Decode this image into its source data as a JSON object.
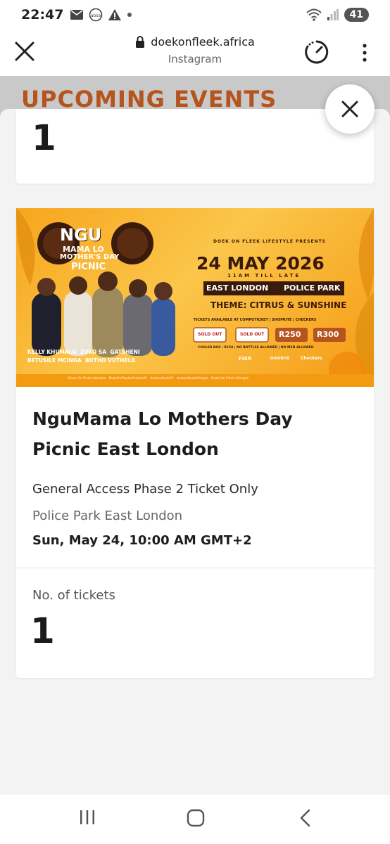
{
  "status_bar": {
    "time": "22:47",
    "battery": "41",
    "icons": [
      "mail-icon",
      "absa-icon",
      "warning-icon",
      "dot-icon",
      "wifi-icon",
      "signal-icon"
    ]
  },
  "browser": {
    "domain": "doekonfleek.africa",
    "subtitle": "Instagram"
  },
  "background_page": {
    "heading": "UPCOMING EVENTS"
  },
  "top_card": {
    "quantity": "1"
  },
  "banner": {
    "presenter": "DOEK ON FLEEK LIFESTYLE PRESENTS",
    "logo_line1": "NGU",
    "logo_line2": "MAMA LO",
    "logo_line3": "MOTHER'S DAY",
    "logo_line4": "PICNIC",
    "date": "24 MAY 2026",
    "time_line": "11AM TILL LATE",
    "city": "EAST LONDON",
    "venue": "POLICE PARK",
    "theme": "THEME: CITRUS & SUNSHINE",
    "tickets_line": "TICKETS AVAILABLE AT COMPUTICKET | SHOPRITE | CHECKERS",
    "sold_out_1": "SOLD OUT",
    "sold_out_2": "SOLD OUT",
    "price_1": "R250",
    "price_2": "R300",
    "rules": "COOLER BOX : R150 | NO BOTTLES ALLOWED | NO MEN ALLOWED",
    "artists_row1": "KELLY KHUMALO  ZUKO SA  GATSHENI",
    "artists_row2": "BETUSILE MCINGA  BUTHO VUTHELA",
    "sponsor_1": "FIXR",
    "sponsor_2": "SHOPRITE",
    "sponsor_3": "Checkers",
    "socials": "Doek On Fleek Lifestyle   DoekOnFleekLifestyle01   doekonfleek01   doekonfleeklifestyle   Doek On Fleek Lifestyle"
  },
  "event": {
    "title": "NguMama Lo Mothers Day Picnic East London",
    "ticket_type": "General Access Phase 2 Ticket Only",
    "venue": "Police Park East London",
    "datetime": "Sun, May 24, 10:00 AM GMT+2",
    "quantity_label": "No. of tickets",
    "quantity": "1"
  },
  "colors": {
    "banner_orange": "#f7a51d",
    "heading_rust": "#b5541c",
    "banner_dark": "#3a1a0a"
  }
}
